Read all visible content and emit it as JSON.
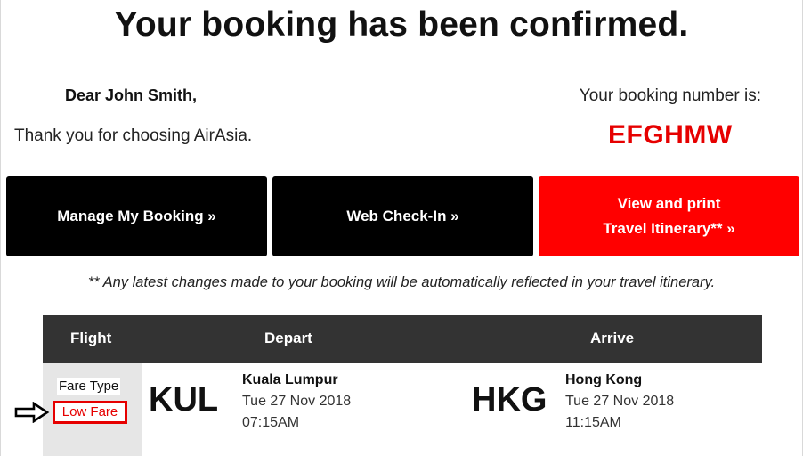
{
  "header": {
    "title": "Your booking has been confirmed."
  },
  "greeting": {
    "dear": "Dear John Smith,",
    "thanks": "Thank you for choosing AirAsia."
  },
  "booking": {
    "label": "Your booking number is:",
    "number": "EFGHMW"
  },
  "actions": {
    "manage_label": "Manage My Booking »",
    "checkin_label": "Web Check-In »",
    "itinerary_line1": "View and print",
    "itinerary_line2": "Travel Itinerary** »"
  },
  "note": "** Any latest changes made to your booking will be automatically reflected in your travel itinerary.",
  "table": {
    "headers": {
      "flight": "Flight",
      "depart": "Depart",
      "arrive": "Arrive"
    },
    "row": {
      "fare_type_label": "Fare Type",
      "fare_type_value": "Low Fare",
      "depart": {
        "code": "KUL",
        "city": "Kuala Lumpur",
        "date": "Tue 27 Nov 2018",
        "time": "07:15AM"
      },
      "arrive": {
        "code": "HKG",
        "city": "Hong Kong",
        "date": "Tue 27 Nov 2018",
        "time": "11:15AM"
      }
    }
  },
  "icons": {
    "pointer": "arrow-right-icon"
  },
  "colors": {
    "accent_red": "#ff0000",
    "booking_number": "#e60000",
    "button_dark": "#000000",
    "table_header": "#333333"
  }
}
